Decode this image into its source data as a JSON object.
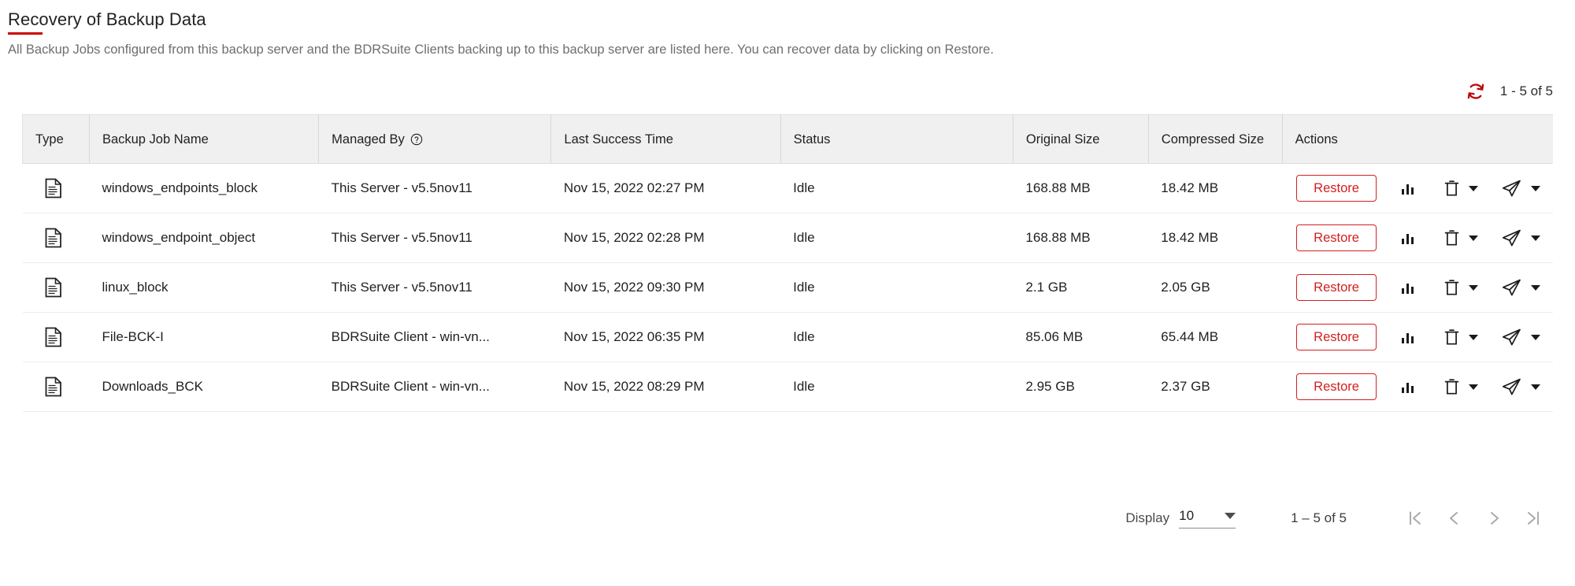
{
  "header": {
    "title": "Recovery of Backup Data",
    "subtitle": "All Backup Jobs configured from this backup server and the BDRSuite Clients backing up to this backup server are listed here. You can recover data by clicking on Restore.",
    "accent_color": "#cc0000"
  },
  "toolbar": {
    "refresh_icon": "refresh-icon",
    "record_count": "1 - 5 of 5"
  },
  "table": {
    "columns": [
      {
        "key": "type",
        "label": "Type"
      },
      {
        "key": "name",
        "label": "Backup Job Name"
      },
      {
        "key": "managed_by",
        "label": "Managed By",
        "help_icon": "help-circle-icon"
      },
      {
        "key": "last_success",
        "label": "Last Success Time"
      },
      {
        "key": "status",
        "label": "Status"
      },
      {
        "key": "original_size",
        "label": "Original Size"
      },
      {
        "key": "compressed_size",
        "label": "Compressed Size"
      },
      {
        "key": "actions",
        "label": "Actions"
      }
    ],
    "rows": [
      {
        "type_icon": "file-document-icon",
        "name": "windows_endpoints_block",
        "managed_by": "This Server - v5.5nov11",
        "last_success": "Nov 15, 2022 02:27 PM",
        "status": "Idle",
        "original_size": "168.88 MB",
        "compressed_size": "18.42 MB",
        "restore_label": "Restore"
      },
      {
        "type_icon": "file-document-icon",
        "name": "windows_endpoint_object",
        "managed_by": "This Server - v5.5nov11",
        "last_success": "Nov 15, 2022 02:28 PM",
        "status": "Idle",
        "original_size": "168.88 MB",
        "compressed_size": "18.42 MB",
        "restore_label": "Restore"
      },
      {
        "type_icon": "file-document-icon",
        "name": "linux_block",
        "managed_by": "This Server - v5.5nov11",
        "last_success": "Nov 15, 2022 09:30 PM",
        "status": "Idle",
        "original_size": "2.1 GB",
        "compressed_size": "2.05 GB",
        "restore_label": "Restore"
      },
      {
        "type_icon": "file-document-icon",
        "name": "File-BCK-I",
        "managed_by": "BDRSuite Client - win-vn...",
        "last_success": "Nov 15, 2022 06:35 PM",
        "status": "Idle",
        "original_size": "85.06 MB",
        "compressed_size": "65.44 MB",
        "restore_label": "Restore"
      },
      {
        "type_icon": "file-document-icon",
        "name": "Downloads_BCK",
        "managed_by": "BDRSuite Client - win-vn...",
        "last_success": "Nov 15, 2022 08:29 PM",
        "status": "Idle",
        "original_size": "2.95 GB",
        "compressed_size": "2.37 GB",
        "restore_label": "Restore"
      }
    ],
    "row_action_icons": {
      "report": "bar-chart-icon",
      "delete": "trash-icon",
      "delete_menu": "chevron-down-icon",
      "send": "send-icon",
      "send_menu": "chevron-down-icon"
    },
    "restore_button_color": "#d32020"
  },
  "pagination": {
    "display_label": "Display",
    "page_size": "10",
    "page_size_caret": "chevron-down-icon",
    "range_text": "1 – 5 of 5",
    "first_icon": "first-page-icon",
    "prev_icon": "prev-page-icon",
    "next_icon": "next-page-icon",
    "last_icon": "last-page-icon"
  }
}
